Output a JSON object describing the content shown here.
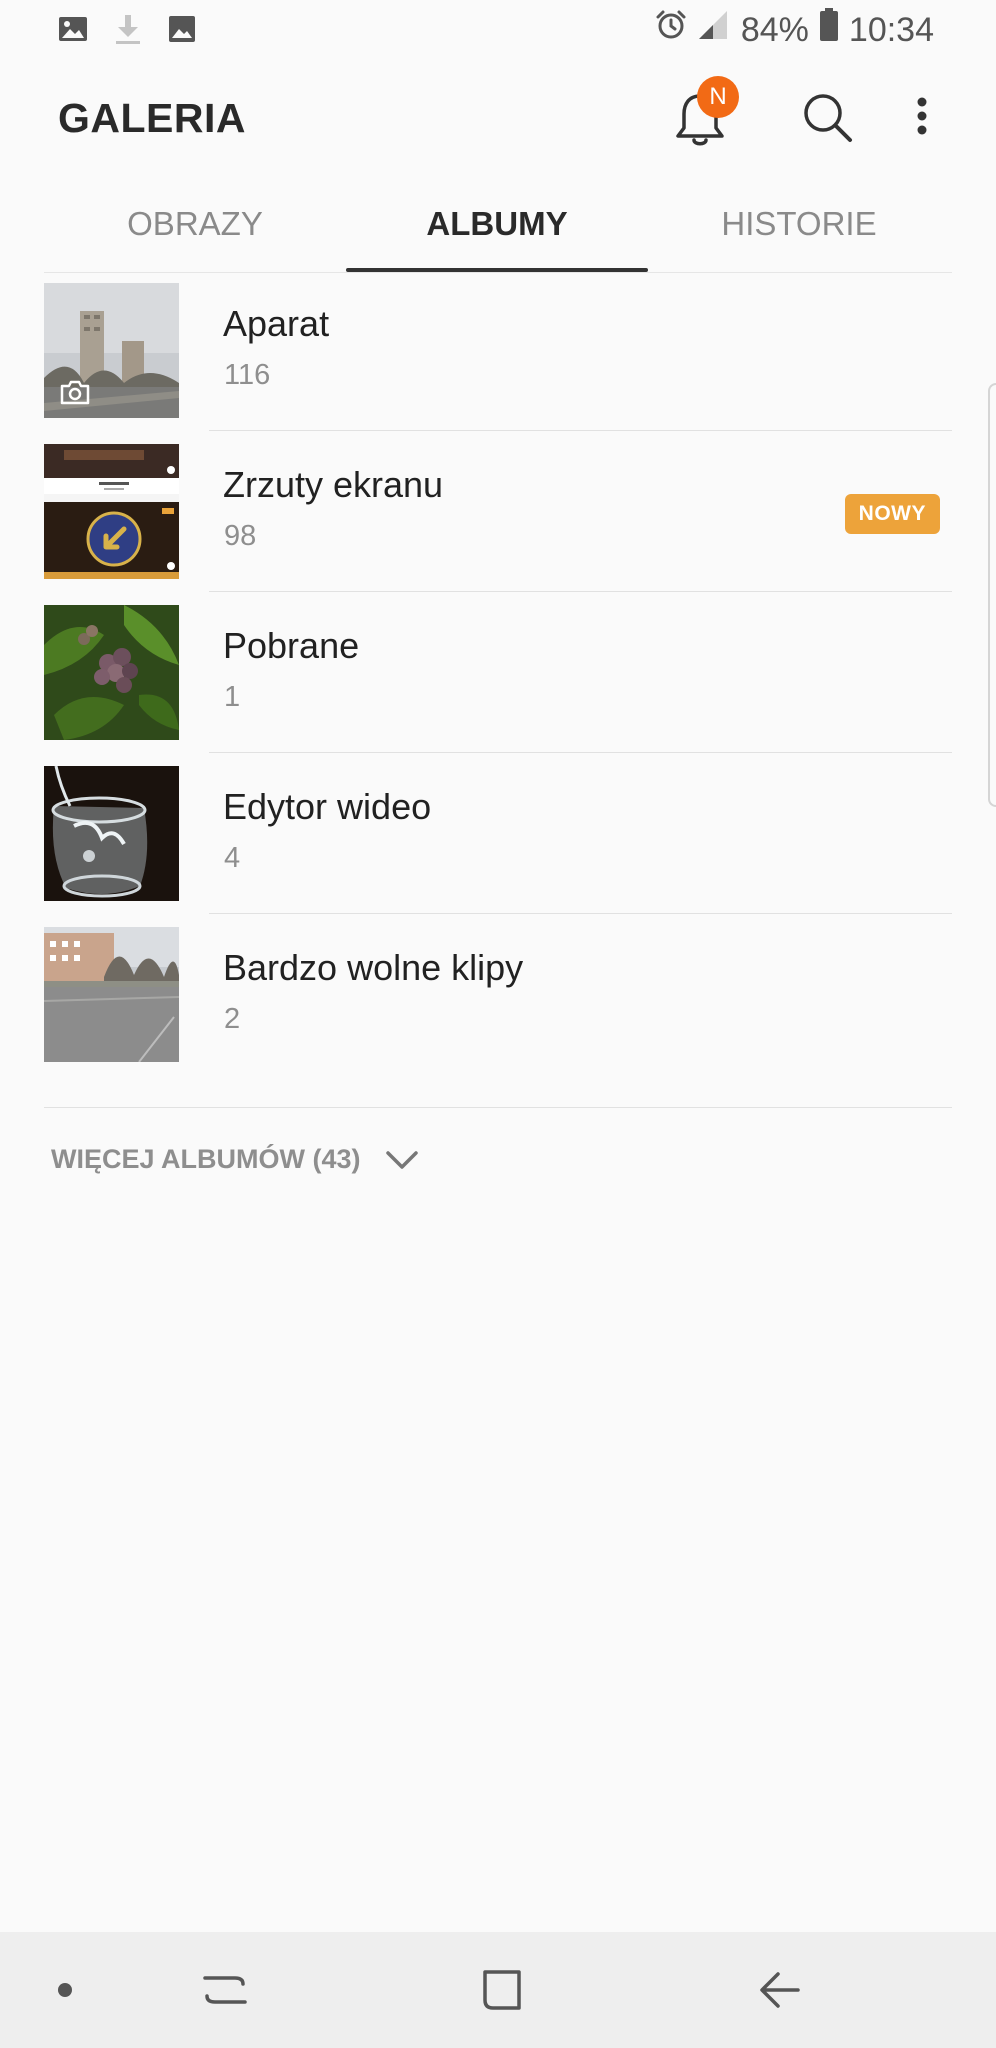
{
  "status_bar": {
    "battery": "84%",
    "time": "10:34",
    "left_icons": [
      "gallery-icon",
      "download-icon",
      "image-icon"
    ],
    "right_icons": [
      "alarm-icon",
      "signal-icon",
      "battery-icon"
    ]
  },
  "app_bar": {
    "title": "GALERIA",
    "notification_badge": "N",
    "accent_color": "#f26a15"
  },
  "tabs": [
    {
      "label": "OBRAZY",
      "selected": false
    },
    {
      "label": "ALBUMY",
      "selected": true
    },
    {
      "label": "HISTORIE",
      "selected": false
    }
  ],
  "albums": [
    {
      "name": "Aparat",
      "count": "116",
      "badge": ""
    },
    {
      "name": "Zrzuty ekranu",
      "count": "98",
      "badge": "NOWY"
    },
    {
      "name": "Pobrane",
      "count": "1",
      "badge": ""
    },
    {
      "name": "Edytor wideo",
      "count": "4",
      "badge": ""
    },
    {
      "name": "Bardzo wolne klipy",
      "count": "2",
      "badge": ""
    }
  ],
  "more_albums_label": "WIĘCEJ ALBUMÓW (43)",
  "badge_color": "#eda33a"
}
